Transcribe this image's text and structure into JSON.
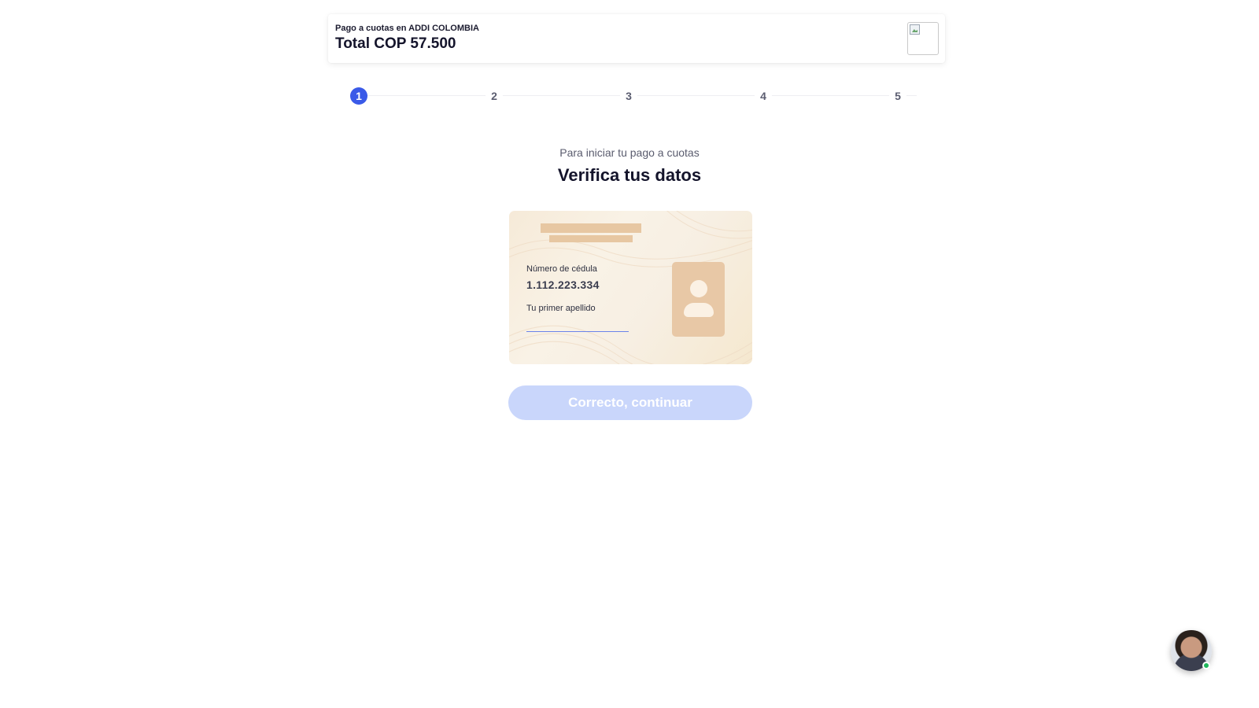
{
  "header": {
    "merchant_line": "Pago a cuotas en ADDI COLOMBIA",
    "total": "Total COP 57.500",
    "logo_icon": "broken-image-icon"
  },
  "stepper": {
    "current": 1,
    "steps": [
      "1",
      "2",
      "3",
      "4",
      "5"
    ]
  },
  "main": {
    "subtitle": "Para iniciar tu pago a cuotas",
    "title": "Verifica tus datos"
  },
  "id_card": {
    "cedula_label": "Número de cédula",
    "cedula_value": "1.112.223.334",
    "apellido_label": "Tu primer apellido",
    "apellido_value": "",
    "photo_icon": "person-silhouette-icon"
  },
  "actions": {
    "continue_label": "Correcto, continuar"
  },
  "chat": {
    "avatar_icon": "support-agent-avatar",
    "status": "online"
  },
  "colors": {
    "accent": "#3a5ae8",
    "button_disabled": "#c9d6fb",
    "card_background": "#f7efe3",
    "online": "#1fb85c"
  }
}
